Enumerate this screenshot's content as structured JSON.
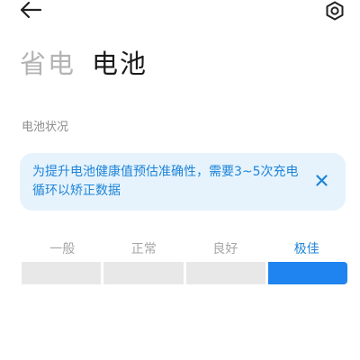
{
  "header": {
    "back_icon": "arrow-left-icon",
    "settings_icon": "hex-nut-settings-icon"
  },
  "tabs": [
    {
      "label": "省电",
      "active": false
    },
    {
      "label": "电池",
      "active": true
    }
  ],
  "section": {
    "title": "电池状况"
  },
  "notice": {
    "text": "为提升电池健康值预估准确性，需要3~5次充电循环以矫正数据",
    "close_icon": "close-x-icon",
    "background": "#e6f3fd",
    "text_color": "#1f84d8"
  },
  "health": {
    "levels": [
      "一般",
      "正常",
      "良好",
      "极佳"
    ],
    "current_index": 3,
    "current_label": "极佳",
    "accent": "#1f84ef",
    "inactive_color": "#e8e8e8"
  }
}
